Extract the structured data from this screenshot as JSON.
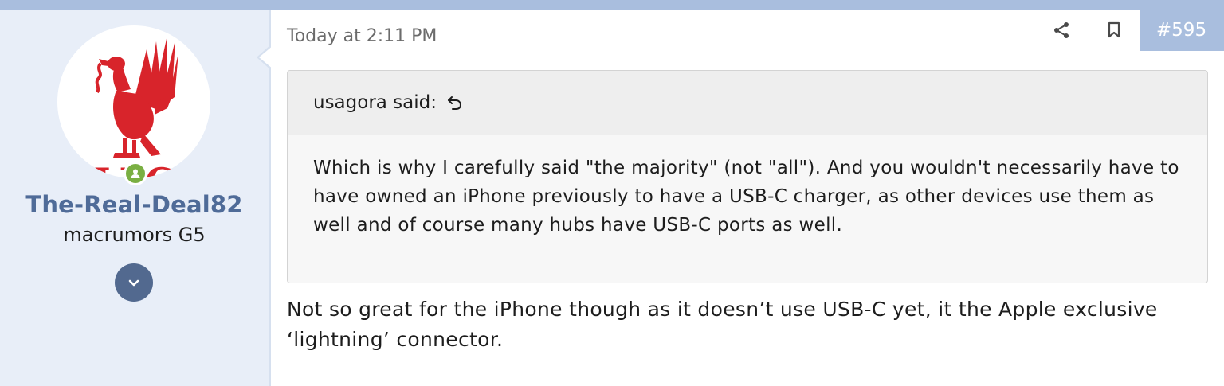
{
  "post": {
    "number": "#595",
    "timestamp": "Today at 2:11 PM",
    "body": "Not so great for the iPhone though as it doesn’t use USB-C yet, it the Apple exclusive ‘lightning’ connector."
  },
  "author": {
    "username": "The-Real-Deal82",
    "title": "macrumors G5",
    "avatar_logo_text": "LFC",
    "online": true
  },
  "quote": {
    "author_label": "usagora said:",
    "text": "Which is why I carefully said \"the majority\" (not \"all\"). And you wouldn't necessarily have to have owned an iPhone previously to have a USB-C charger, as other devices use them as well and of course many hubs have USB-C ports as well."
  },
  "icons": {
    "share": "share-icon",
    "bookmark": "bookmark-icon",
    "quote_jump": "arrow-back-icon",
    "expand": "chevron-down-icon",
    "online": "user-icon"
  },
  "colors": {
    "accent": "#a9bede",
    "username": "#4f6b98",
    "sidebar_bg": "#e8eef8",
    "expand_button": "#52698f",
    "online_dot": "#7aaf42",
    "avatar_logo": "#d8242b"
  }
}
